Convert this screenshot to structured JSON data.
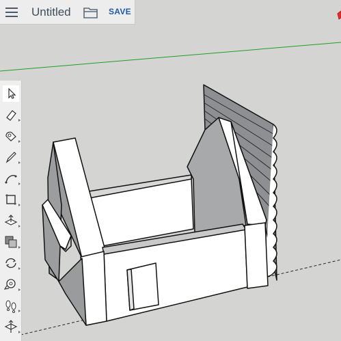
{
  "document": {
    "title": "Untitled"
  },
  "header": {
    "save_label": "SAVE"
  },
  "icons": {
    "menu": "hamburger-menu-icon",
    "open": "folder-open-icon"
  },
  "tools": [
    {
      "name": "select",
      "icon": "cursor-arrow-icon",
      "active": true
    },
    {
      "name": "eraser",
      "icon": "eraser-icon"
    },
    {
      "name": "paint-bucket",
      "icon": "paint-bucket-icon"
    },
    {
      "name": "pencil",
      "icon": "pencil-icon"
    },
    {
      "name": "arc",
      "icon": "arc-icon"
    },
    {
      "name": "rectangle",
      "icon": "rectangle-icon"
    },
    {
      "name": "push-pull",
      "icon": "push-pull-icon"
    },
    {
      "name": "offset",
      "icon": "offset-icon"
    },
    {
      "name": "orbit",
      "icon": "orbit-icon"
    },
    {
      "name": "tape-measure",
      "icon": "tape-measure-icon"
    },
    {
      "name": "walk",
      "icon": "footprints-icon"
    },
    {
      "name": "section-plane",
      "icon": "section-plane-icon"
    }
  ],
  "colors": {
    "toolbar_bg": "#efefef",
    "canvas_bg": "#d4d4d2",
    "save_accent": "#1e5aa8",
    "green_axis": "#1f9e1f",
    "red_axis": "#e03030"
  }
}
